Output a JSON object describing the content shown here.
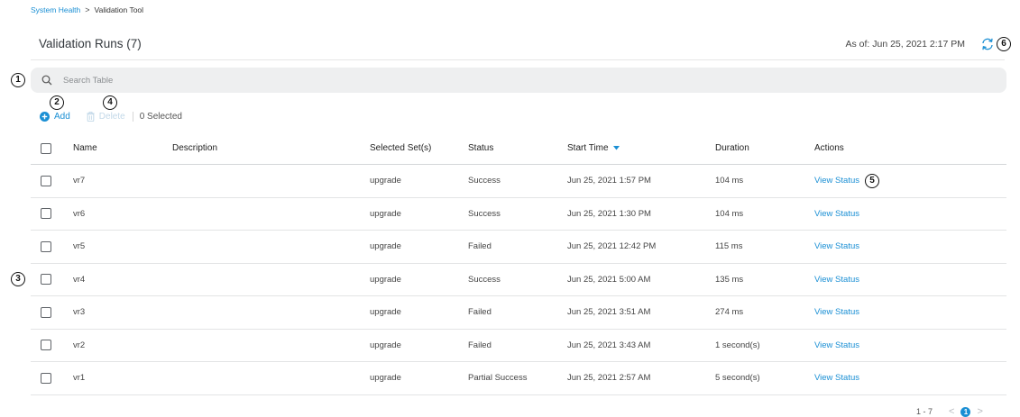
{
  "breadcrumb": {
    "parent": "System Health",
    "separator": ">",
    "current": "Validation Tool"
  },
  "page": {
    "title": "Validation Runs (7)",
    "as_of": "As of: Jun 25, 2021 2:17 PM"
  },
  "callouts": {
    "c1": "1",
    "c2": "2",
    "c3": "3",
    "c4": "4",
    "c5": "5",
    "c6": "6"
  },
  "search": {
    "placeholder": "Search Table",
    "value": ""
  },
  "toolbar": {
    "add_label": "Add",
    "delete_label": "Delete",
    "selected_text": "0 Selected"
  },
  "table": {
    "headers": {
      "name": "Name",
      "description": "Description",
      "sets": "Selected Set(s)",
      "status": "Status",
      "start": "Start Time",
      "duration": "Duration",
      "actions": "Actions"
    },
    "rows": [
      {
        "name": "vr7",
        "description": "",
        "sets": "upgrade",
        "status": "Success",
        "start": "Jun 25, 2021 1:57 PM",
        "duration": "104 ms",
        "action": "View Status"
      },
      {
        "name": "vr6",
        "description": "",
        "sets": "upgrade",
        "status": "Success",
        "start": "Jun 25, 2021 1:30 PM",
        "duration": "104 ms",
        "action": "View Status"
      },
      {
        "name": "vr5",
        "description": "",
        "sets": "upgrade",
        "status": "Failed",
        "start": "Jun 25, 2021 12:42 PM",
        "duration": "115 ms",
        "action": "View Status"
      },
      {
        "name": "vr4",
        "description": "",
        "sets": "upgrade",
        "status": "Success",
        "start": "Jun 25, 2021 5:00 AM",
        "duration": "135 ms",
        "action": "View Status"
      },
      {
        "name": "vr3",
        "description": "",
        "sets": "upgrade",
        "status": "Failed",
        "start": "Jun 25, 2021 3:51 AM",
        "duration": "274 ms",
        "action": "View Status"
      },
      {
        "name": "vr2",
        "description": "",
        "sets": "upgrade",
        "status": "Failed",
        "start": "Jun 25, 2021 3:43 AM",
        "duration": "1 second(s)",
        "action": "View Status"
      },
      {
        "name": "vr1",
        "description": "",
        "sets": "upgrade",
        "status": "Partial Success",
        "start": "Jun 25, 2021 2:57 AM",
        "duration": "5 second(s)",
        "action": "View Status"
      }
    ]
  },
  "pagination": {
    "range": "1 - 7",
    "current": "1",
    "prev": "<",
    "next": ">"
  },
  "colors": {
    "accent": "#1a8fd4",
    "disabled": "#c2d8e8",
    "search_bg": "#eeeff0",
    "divider": "#e3e4e5"
  },
  "icons": {
    "search": "search-icon",
    "refresh": "refresh-icon",
    "add": "plus-circle-icon",
    "delete": "trash-icon",
    "sort": "sort-down-icon"
  }
}
